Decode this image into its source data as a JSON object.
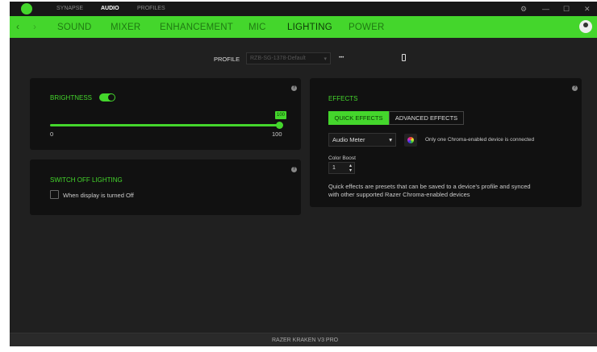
{
  "titlebar": {
    "tabs": [
      "SYNAPSE",
      "AUDIO",
      "PROFILES"
    ],
    "active": "AUDIO"
  },
  "nav": {
    "tabs": [
      "SOUND",
      "MIXER",
      "ENHANCEMENT",
      "MIC",
      "LIGHTING",
      "POWER"
    ],
    "active": "LIGHTING"
  },
  "profile": {
    "label": "PROFILE",
    "value": "RZB-SG-1378-Default",
    "more": "•••"
  },
  "brightness": {
    "title": "BRIGHTNESS",
    "enabled": true,
    "value": "100",
    "min": "0",
    "max": "100",
    "percent": 100
  },
  "switch_off": {
    "title": "SWITCH OFF LIGHTING",
    "option": "When display is turned Off",
    "checked": false
  },
  "effects": {
    "title": "EFFECTS",
    "tabs": [
      "QUICK EFFECTS",
      "ADVANCED EFFECTS"
    ],
    "active": "QUICK EFFECTS",
    "effect": "Audio Meter",
    "chroma_note": "Only one Chroma-enabled device is connected",
    "color_boost_label": "Color Boost",
    "color_boost": "1",
    "description": "Quick effects are presets that can be saved to a device's profile and synced with other supported Razer Chroma-enabled devices"
  },
  "help": "?",
  "footer": {
    "device": "RAZER KRAKEN V3 PRO"
  },
  "colors": {
    "accent": "#44d62c"
  }
}
